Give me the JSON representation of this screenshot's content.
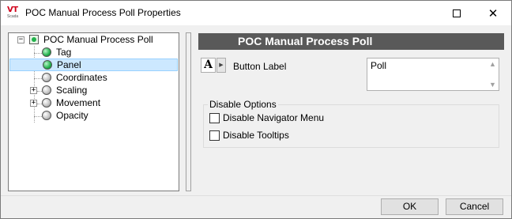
{
  "window": {
    "title": "POC Manual Process Poll Properties",
    "logo_text": "VT",
    "logo_subtext": "Scada",
    "close_glyph": "✕"
  },
  "tree": {
    "root": {
      "label": "POC Manual Process Poll",
      "expander": "−",
      "icon": "root-node-icon"
    },
    "items": [
      {
        "label": "Tag",
        "icon": "green-ball-icon"
      },
      {
        "label": "Panel",
        "icon": "green-ball-icon",
        "selected": true
      },
      {
        "label": "Coordinates",
        "icon": "grey-ball-icon"
      },
      {
        "label": "Scaling",
        "icon": "grey-ball-icon",
        "expander": "+"
      },
      {
        "label": "Movement",
        "icon": "grey-ball-icon",
        "expander": "+"
      },
      {
        "label": "Opacity",
        "icon": "grey-ball-icon"
      }
    ]
  },
  "panel": {
    "header": "POC Manual Process Poll",
    "font_button_glyph": "A",
    "font_arrow_glyph": "▶",
    "button_label_caption": "Button Label",
    "button_label_value": "Poll",
    "scroll_up_glyph": "▲",
    "scroll_down_glyph": "▼",
    "disable_group": {
      "legend": "Disable Options",
      "options": [
        {
          "label": "Disable Navigator Menu",
          "checked": false
        },
        {
          "label": "Disable Tooltips",
          "checked": false
        }
      ]
    }
  },
  "footer": {
    "ok_label": "OK",
    "cancel_label": "Cancel"
  },
  "colors": {
    "header_bg": "#595959",
    "selection_bg": "#cce8ff",
    "status_green": "#22b14c",
    "logo_red": "#d0021b"
  }
}
